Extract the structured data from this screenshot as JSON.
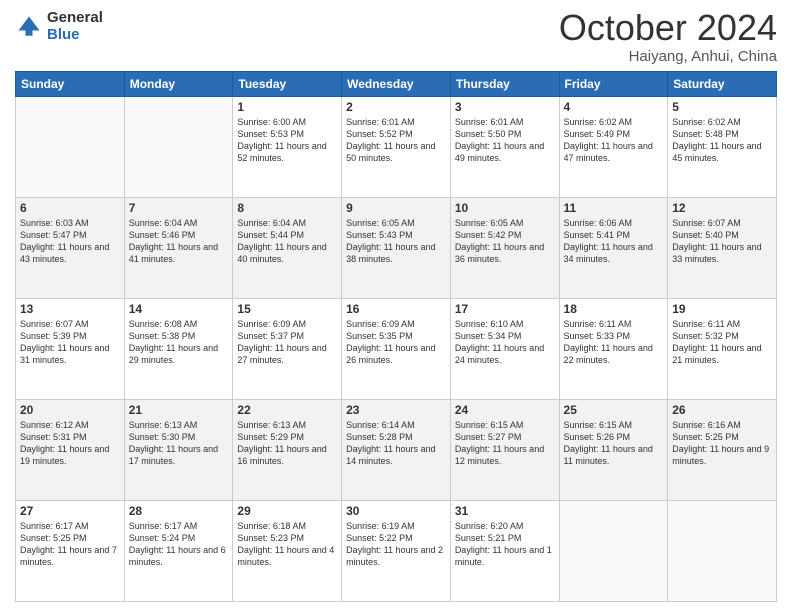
{
  "header": {
    "logo_general": "General",
    "logo_blue": "Blue",
    "month_title": "October 2024",
    "subtitle": "Haiyang, Anhui, China"
  },
  "weekdays": [
    "Sunday",
    "Monday",
    "Tuesday",
    "Wednesday",
    "Thursday",
    "Friday",
    "Saturday"
  ],
  "weeks": [
    [
      {
        "day": "",
        "sunrise": "",
        "sunset": "",
        "daylight": ""
      },
      {
        "day": "",
        "sunrise": "",
        "sunset": "",
        "daylight": ""
      },
      {
        "day": "1",
        "sunrise": "Sunrise: 6:00 AM",
        "sunset": "Sunset: 5:53 PM",
        "daylight": "Daylight: 11 hours and 52 minutes."
      },
      {
        "day": "2",
        "sunrise": "Sunrise: 6:01 AM",
        "sunset": "Sunset: 5:52 PM",
        "daylight": "Daylight: 11 hours and 50 minutes."
      },
      {
        "day": "3",
        "sunrise": "Sunrise: 6:01 AM",
        "sunset": "Sunset: 5:50 PM",
        "daylight": "Daylight: 11 hours and 49 minutes."
      },
      {
        "day": "4",
        "sunrise": "Sunrise: 6:02 AM",
        "sunset": "Sunset: 5:49 PM",
        "daylight": "Daylight: 11 hours and 47 minutes."
      },
      {
        "day": "5",
        "sunrise": "Sunrise: 6:02 AM",
        "sunset": "Sunset: 5:48 PM",
        "daylight": "Daylight: 11 hours and 45 minutes."
      }
    ],
    [
      {
        "day": "6",
        "sunrise": "Sunrise: 6:03 AM",
        "sunset": "Sunset: 5:47 PM",
        "daylight": "Daylight: 11 hours and 43 minutes."
      },
      {
        "day": "7",
        "sunrise": "Sunrise: 6:04 AM",
        "sunset": "Sunset: 5:46 PM",
        "daylight": "Daylight: 11 hours and 41 minutes."
      },
      {
        "day": "8",
        "sunrise": "Sunrise: 6:04 AM",
        "sunset": "Sunset: 5:44 PM",
        "daylight": "Daylight: 11 hours and 40 minutes."
      },
      {
        "day": "9",
        "sunrise": "Sunrise: 6:05 AM",
        "sunset": "Sunset: 5:43 PM",
        "daylight": "Daylight: 11 hours and 38 minutes."
      },
      {
        "day": "10",
        "sunrise": "Sunrise: 6:05 AM",
        "sunset": "Sunset: 5:42 PM",
        "daylight": "Daylight: 11 hours and 36 minutes."
      },
      {
        "day": "11",
        "sunrise": "Sunrise: 6:06 AM",
        "sunset": "Sunset: 5:41 PM",
        "daylight": "Daylight: 11 hours and 34 minutes."
      },
      {
        "day": "12",
        "sunrise": "Sunrise: 6:07 AM",
        "sunset": "Sunset: 5:40 PM",
        "daylight": "Daylight: 11 hours and 33 minutes."
      }
    ],
    [
      {
        "day": "13",
        "sunrise": "Sunrise: 6:07 AM",
        "sunset": "Sunset: 5:39 PM",
        "daylight": "Daylight: 11 hours and 31 minutes."
      },
      {
        "day": "14",
        "sunrise": "Sunrise: 6:08 AM",
        "sunset": "Sunset: 5:38 PM",
        "daylight": "Daylight: 11 hours and 29 minutes."
      },
      {
        "day": "15",
        "sunrise": "Sunrise: 6:09 AM",
        "sunset": "Sunset: 5:37 PM",
        "daylight": "Daylight: 11 hours and 27 minutes."
      },
      {
        "day": "16",
        "sunrise": "Sunrise: 6:09 AM",
        "sunset": "Sunset: 5:35 PM",
        "daylight": "Daylight: 11 hours and 26 minutes."
      },
      {
        "day": "17",
        "sunrise": "Sunrise: 6:10 AM",
        "sunset": "Sunset: 5:34 PM",
        "daylight": "Daylight: 11 hours and 24 minutes."
      },
      {
        "day": "18",
        "sunrise": "Sunrise: 6:11 AM",
        "sunset": "Sunset: 5:33 PM",
        "daylight": "Daylight: 11 hours and 22 minutes."
      },
      {
        "day": "19",
        "sunrise": "Sunrise: 6:11 AM",
        "sunset": "Sunset: 5:32 PM",
        "daylight": "Daylight: 11 hours and 21 minutes."
      }
    ],
    [
      {
        "day": "20",
        "sunrise": "Sunrise: 6:12 AM",
        "sunset": "Sunset: 5:31 PM",
        "daylight": "Daylight: 11 hours and 19 minutes."
      },
      {
        "day": "21",
        "sunrise": "Sunrise: 6:13 AM",
        "sunset": "Sunset: 5:30 PM",
        "daylight": "Daylight: 11 hours and 17 minutes."
      },
      {
        "day": "22",
        "sunrise": "Sunrise: 6:13 AM",
        "sunset": "Sunset: 5:29 PM",
        "daylight": "Daylight: 11 hours and 16 minutes."
      },
      {
        "day": "23",
        "sunrise": "Sunrise: 6:14 AM",
        "sunset": "Sunset: 5:28 PM",
        "daylight": "Daylight: 11 hours and 14 minutes."
      },
      {
        "day": "24",
        "sunrise": "Sunrise: 6:15 AM",
        "sunset": "Sunset: 5:27 PM",
        "daylight": "Daylight: 11 hours and 12 minutes."
      },
      {
        "day": "25",
        "sunrise": "Sunrise: 6:15 AM",
        "sunset": "Sunset: 5:26 PM",
        "daylight": "Daylight: 11 hours and 11 minutes."
      },
      {
        "day": "26",
        "sunrise": "Sunrise: 6:16 AM",
        "sunset": "Sunset: 5:25 PM",
        "daylight": "Daylight: 11 hours and 9 minutes."
      }
    ],
    [
      {
        "day": "27",
        "sunrise": "Sunrise: 6:17 AM",
        "sunset": "Sunset: 5:25 PM",
        "daylight": "Daylight: 11 hours and 7 minutes."
      },
      {
        "day": "28",
        "sunrise": "Sunrise: 6:17 AM",
        "sunset": "Sunset: 5:24 PM",
        "daylight": "Daylight: 11 hours and 6 minutes."
      },
      {
        "day": "29",
        "sunrise": "Sunrise: 6:18 AM",
        "sunset": "Sunset: 5:23 PM",
        "daylight": "Daylight: 11 hours and 4 minutes."
      },
      {
        "day": "30",
        "sunrise": "Sunrise: 6:19 AM",
        "sunset": "Sunset: 5:22 PM",
        "daylight": "Daylight: 11 hours and 2 minutes."
      },
      {
        "day": "31",
        "sunrise": "Sunrise: 6:20 AM",
        "sunset": "Sunset: 5:21 PM",
        "daylight": "Daylight: 11 hours and 1 minute."
      },
      {
        "day": "",
        "sunrise": "",
        "sunset": "",
        "daylight": ""
      },
      {
        "day": "",
        "sunrise": "",
        "sunset": "",
        "daylight": ""
      }
    ]
  ]
}
